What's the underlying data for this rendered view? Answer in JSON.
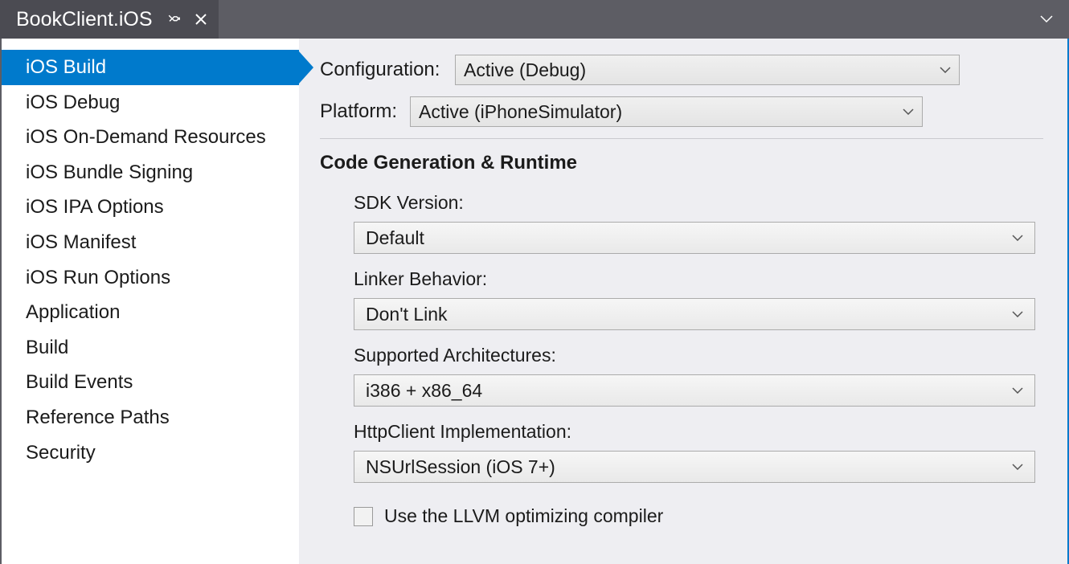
{
  "tab": {
    "title": "BookClient.iOS"
  },
  "sidebar": {
    "items": [
      "iOS Build",
      "iOS Debug",
      "iOS On-Demand Resources",
      "iOS Bundle Signing",
      "iOS IPA Options",
      "iOS Manifest",
      "iOS Run Options",
      "Application",
      "Build",
      "Build Events",
      "Reference Paths",
      "Security"
    ],
    "activeIndex": 0
  },
  "header": {
    "configuration_label": "Configuration:",
    "configuration_value": "Active (Debug)",
    "platform_label": "Platform:",
    "platform_value": "Active (iPhoneSimulator)"
  },
  "section": {
    "title": "Code Generation & Runtime",
    "sdk_label": "SDK Version:",
    "sdk_value": "Default",
    "linker_label": "Linker Behavior:",
    "linker_value": "Don't Link",
    "arch_label": "Supported Architectures:",
    "arch_value": "i386 + x86_64",
    "http_label": "HttpClient Implementation:",
    "http_value": "NSUrlSession (iOS 7+)",
    "llvm_label": "Use the LLVM optimizing compiler"
  }
}
